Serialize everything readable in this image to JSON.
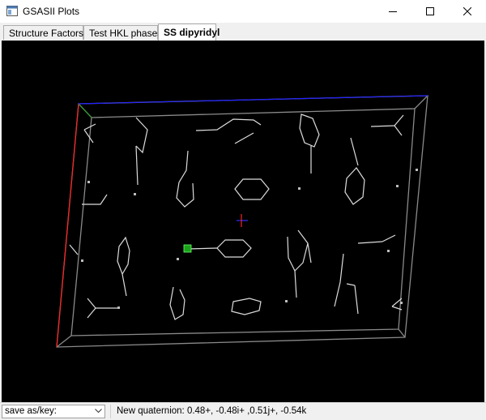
{
  "window": {
    "title": "GSASII Plots"
  },
  "tabs": [
    {
      "label": "Structure Factors",
      "active": false
    },
    {
      "label": "Test HKL phases",
      "active": false
    },
    {
      "label": "SS dipyridyl",
      "active": true
    }
  ],
  "plot": {
    "background": "#000000",
    "cell_edge_color": "#8a8a8a",
    "bond_color": "#dcdcdc",
    "selected_atom_color": "#1aa31a",
    "axis_colors": {
      "a": "#ff2020",
      "b": "#2a9a2a",
      "c": "#2020ff"
    }
  },
  "statusbar": {
    "save_combo_value": "save as/key:",
    "status_message": "New quaternion: 0.48+, -0.48i+ ,0.51j+, -0.54k"
  },
  "icons": {
    "app": "window-icon",
    "minimize": "minimize-icon",
    "maximize": "maximize-icon",
    "close": "close-icon",
    "dropdown": "chevron-down-icon"
  }
}
